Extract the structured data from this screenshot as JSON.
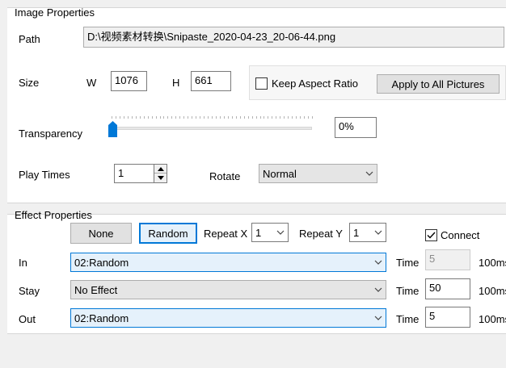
{
  "image_properties": {
    "title": "Image Properties",
    "path_label": "Path",
    "path_value": "D:\\视频素材转换\\Snipaste_2020-04-23_20-06-44.png",
    "size_label": "Size",
    "w_label": "W",
    "w_value": "1076",
    "h_label": "H",
    "h_value": "661",
    "keep_aspect_label": "Keep Aspect Ratio",
    "keep_aspect_checked": false,
    "apply_all_label": "Apply to All Pictures",
    "transparency_label": "Transparency",
    "transparency_value": "0%",
    "transparency_level": 0,
    "play_times_label": "Play Times",
    "play_times_value": "1",
    "rotate_label": "Rotate",
    "rotate_value": "Normal"
  },
  "effect_properties": {
    "title": "Effect Properties",
    "none_label": "None",
    "random_label": "Random",
    "repeat_x_label": "Repeat X",
    "repeat_x_value": "1",
    "repeat_y_label": "Repeat Y",
    "repeat_y_value": "1",
    "connect_label": "Connect",
    "connect_checked": true,
    "rows": [
      {
        "label": "In",
        "effect": "02:Random",
        "time_label": "Time",
        "time_value": "5",
        "unit": "100ms",
        "time_enabled": false
      },
      {
        "label": "Stay",
        "effect": "No Effect",
        "time_label": "Time",
        "time_value": "50",
        "unit": "100ms",
        "time_enabled": true
      },
      {
        "label": "Out",
        "effect": "02:Random",
        "time_label": "Time",
        "time_value": "5",
        "unit": "100ms",
        "time_enabled": true
      }
    ]
  },
  "colors": {
    "accent": "#0078d7",
    "thumb": "#0078d7",
    "panel_bg": "#ffffff",
    "window_bg": "#f0f0f0"
  },
  "icons": {
    "dropdown": "chevron-down-icon",
    "check": "checkmark-icon",
    "spin_up": "triangle-up-icon",
    "spin_down": "triangle-down-icon",
    "slider_thumb": "slider-thumb-icon"
  }
}
